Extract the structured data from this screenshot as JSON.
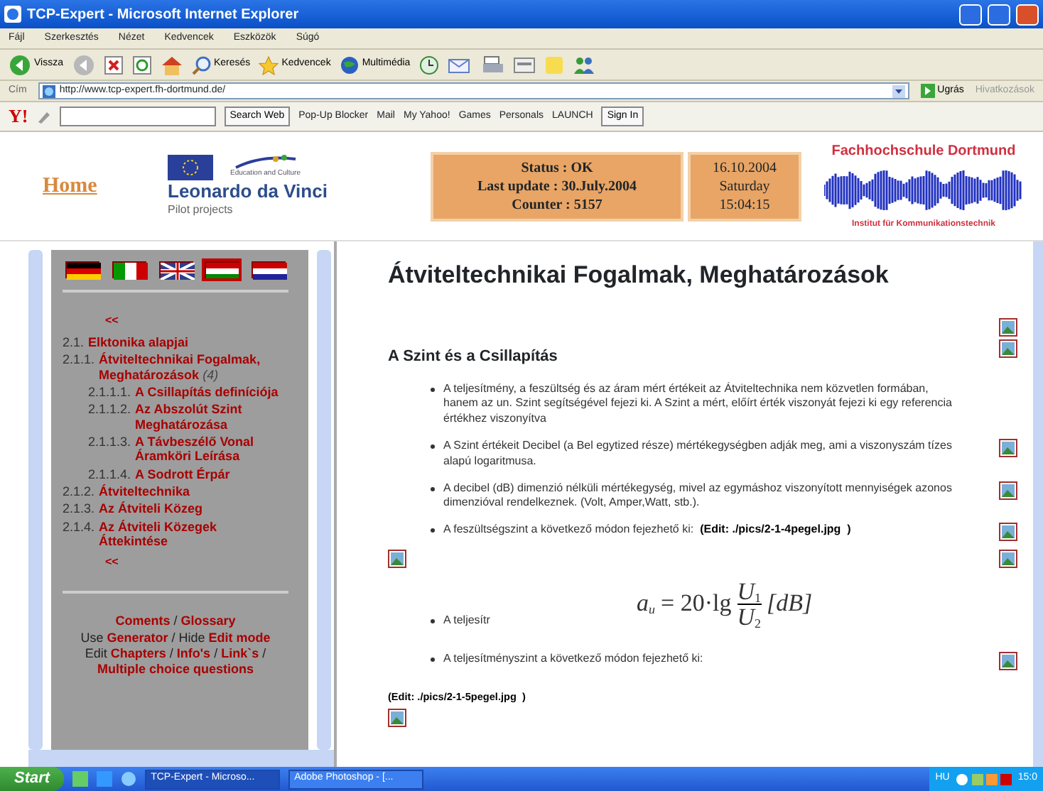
{
  "window": {
    "title": "TCP-Expert - Microsoft Internet Explorer"
  },
  "menu": [
    "Fájl",
    "Szerkesztés",
    "Nézet",
    "Kedvencek",
    "Eszközök",
    "Súgó"
  ],
  "toolbar": {
    "back": "Vissza",
    "search": "Keresés",
    "favorites": "Kedvencek",
    "media": "Multimédia"
  },
  "address": {
    "label": "Cím",
    "value": "http://www.tcp-expert.fh-dortmund.de/",
    "go": "Ugrás",
    "links": "Hivatkozások"
  },
  "yahoo_bar": {
    "logo": "Y!",
    "search_button": "Search Web",
    "items": [
      "Pop-Up Blocker",
      "Mail",
      "My Yahoo!",
      "Games",
      "Personals",
      "LAUNCH"
    ],
    "sign_in": "Sign In"
  },
  "header": {
    "home": "Home",
    "eu_caption": "Education and Culture",
    "program": "Leonardo da Vinci",
    "program_sub": "Pilot projects",
    "status": [
      "Status : OK",
      "Last update : 30.July.2004",
      "Counter : 5157"
    ],
    "date": [
      "16.10.2004",
      "Saturday",
      "15:04:15"
    ],
    "school": "Fachhochschule Dortmund",
    "institute": "Institut für Kommunikationstechnik"
  },
  "nav": {
    "languages": [
      {
        "kind": "de",
        "selected": false
      },
      {
        "kind": "it",
        "selected": false
      },
      {
        "kind": "uk",
        "selected": false
      },
      {
        "kind": "hu",
        "selected": true
      },
      {
        "kind": "nl",
        "selected": false
      }
    ],
    "back_top": "<<",
    "items": [
      {
        "number": "2.1.",
        "label": "Elktonika alapjai"
      },
      {
        "number": "2.1.1.",
        "label": "Átviteltechnikai Fogalmak, Meghatározások",
        "count": "(4)",
        "children": [
          {
            "number": "2.1.1.1.",
            "label": "A Csillapítás definíciója"
          },
          {
            "number": "2.1.1.2.",
            "label": "Az Abszolút Szint Meghatározása"
          },
          {
            "number": "2.1.1.3.",
            "label": "A Távbeszélő Vonal Áramköri Leírása"
          },
          {
            "number": "2.1.1.4.",
            "label": "A Sodrott Érpár"
          }
        ]
      },
      {
        "number": "2.1.2.",
        "label": "Átviteltechnika"
      },
      {
        "number": "2.1.3.",
        "label": "Az Átviteli Közeg"
      },
      {
        "number": "2.1.4.",
        "label": "Az Átviteli Közegek Áttekintése"
      }
    ],
    "back_bottom": "<<",
    "footer": [
      [
        {
          "text": "Coments",
          "link": true
        },
        {
          "text": " / ",
          "link": false
        },
        {
          "text": "Glossary",
          "link": true
        }
      ],
      [
        {
          "text": "Use ",
          "link": false
        },
        {
          "text": "Generator",
          "link": true
        },
        {
          "text": " / Hide ",
          "link": false
        },
        {
          "text": "Edit mode",
          "link": true
        }
      ],
      [
        {
          "text": "Edit ",
          "link": false
        },
        {
          "text": "Chapters",
          "link": true
        },
        {
          "text": " / ",
          "link": false
        },
        {
          "text": "Info's",
          "link": true
        },
        {
          "text": " / ",
          "link": false
        },
        {
          "text": "Link`s",
          "link": true
        },
        {
          "text": " /",
          "link": false
        }
      ],
      [
        {
          "text": "Multiple choice questions",
          "link": true
        }
      ]
    ]
  },
  "content": {
    "title": "Átviteltechnikai Fogalmak, Meghatározások",
    "blocks": [
      {
        "kind": "images",
        "images": [
          {
            "kind": "right"
          }
        ]
      },
      {
        "kind": "heading",
        "text": "A Szint és a Csillapítás",
        "side_image": true
      },
      {
        "kind": "bullet",
        "text": "A teljesítmény, a feszültség és az áram mért értékeit az Átviteltechnika nem közvetlen formában, hanem az un. Szint segítségével fejezi ki. A Szint a mért, előírt érték viszonyát fejezi ki egy referencia értékhez viszonyítva",
        "side_image": false
      },
      {
        "kind": "bullet",
        "text": "A Szint értékeit Decibel (a Bel egytized része) mértékegységben adják meg, ami a viszonyszám tízes alapú logaritmusa.",
        "side_image": true
      },
      {
        "kind": "bullet",
        "text": "A decibel (dB) dimenzió nélküli mértékegység, mivel az egymáshoz viszonyított mennyiségek azonos dimenzióval rendelkeznek. (Volt, Amper,Watt, stb.).",
        "side_image": true
      },
      {
        "kind": "bullet",
        "text": "A feszültségszint a következő módon fejezhető ki:",
        "edit": "(Edit: ./pics/2-1-4pegel.jpg  )",
        "side_image": true
      },
      {
        "kind": "images",
        "images": [
          {
            "kind": "left"
          },
          {
            "kind": "right"
          }
        ]
      },
      {
        "kind": "formula",
        "text": "A teljesítr",
        "formula": {
          "lhs": "a",
          "lhs_sub": "u",
          "middle": "= 20·lg",
          "num": "U",
          "num_sub": "1",
          "den": "U",
          "den_sub": "2",
          "unit": "[dB]"
        }
      },
      {
        "kind": "bullet",
        "text": "A teljesítményszint a következő módon fejezhető ki:",
        "side_image": true
      },
      {
        "kind": "edit",
        "text": "(Edit: ./pics/2-1-5pegel.jpg  )"
      },
      {
        "kind": "images",
        "images": [
          {
            "kind": "left"
          }
        ]
      }
    ]
  },
  "taskbar": {
    "start": "Start",
    "tasks": [
      {
        "label": "TCP-Expert - Microso...",
        "selected": true
      },
      {
        "label": "Adobe Photoshop - [...",
        "selected": false
      }
    ],
    "tray_lang": "HU",
    "clock": "15:0"
  }
}
